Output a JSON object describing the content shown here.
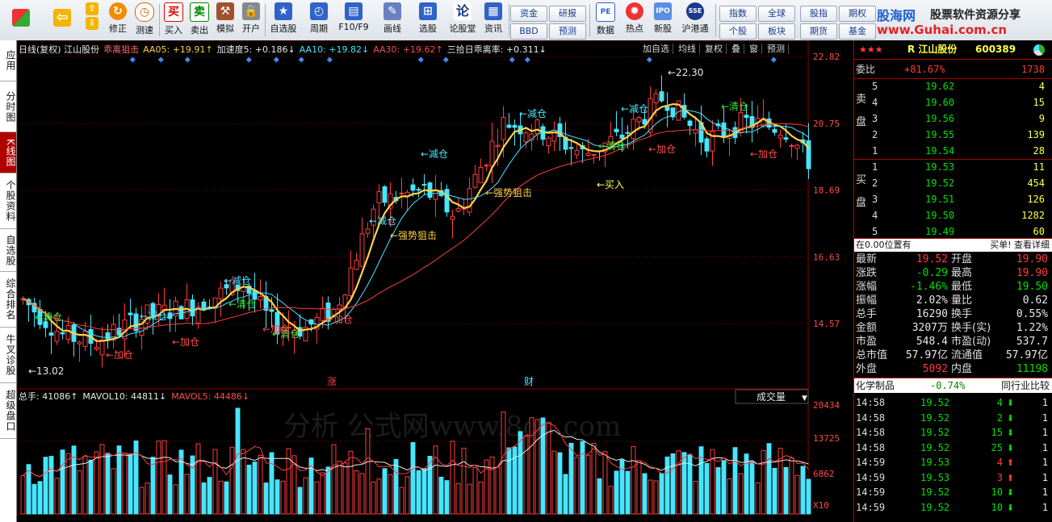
{
  "toolbar": {
    "buttons": [
      {
        "label": "",
        "icon": "app-grid-icon"
      },
      {
        "label": "",
        "icon": "back-arrow-icon"
      },
      {
        "label": "修正",
        "icon": "fix-icon"
      },
      {
        "label": "测速",
        "icon": "speed-icon"
      },
      {
        "label": "买入",
        "icon": "buy-icon"
      },
      {
        "label": "卖出",
        "icon": "sell-icon"
      },
      {
        "label": "模拟",
        "icon": "simulate-icon"
      },
      {
        "label": "开户",
        "icon": "lock-icon"
      },
      {
        "label": "自选股",
        "icon": "star-icon"
      },
      {
        "label": "周期",
        "icon": "clock-icon"
      },
      {
        "label": "F10/F9",
        "icon": "info-icon"
      },
      {
        "label": "画线",
        "icon": "pen-icon"
      },
      {
        "label": "选股",
        "icon": "select-icon"
      },
      {
        "label": "论股堂",
        "icon": "forum-icon"
      },
      {
        "label": "资讯",
        "icon": "news-icon"
      },
      {
        "label": "数据",
        "icon": "pe-icon"
      },
      {
        "label": "热点",
        "icon": "hot-icon"
      },
      {
        "label": "新股",
        "icon": "ipo-icon"
      },
      {
        "label": "沪港通",
        "icon": "hk-icon"
      }
    ],
    "small_buttons": [
      "资金",
      "BBD",
      "研报",
      "预测"
    ],
    "right_buttons": [
      "指数",
      "全球",
      "股指",
      "期权",
      "个股",
      "板块",
      "期货",
      "基金"
    ],
    "brand_line1": "股海网",
    "brand_line1b": "股票软件资源分享",
    "brand_line2": "www.Guhai.com.cn"
  },
  "sidebar": [
    "应用",
    "分时图",
    "K线图",
    "个股资料",
    "自选股",
    "综合排名",
    "牛叉诊股",
    "超级盘口"
  ],
  "chart": {
    "header": "日线(复权) 江山股份 乖离狙击 AA05: +19.91↑ 加速度5: +0.186↓ AA10: +19.82↓ AA30: +19.62↑ 三拾日乖离率: +0.311↓",
    "header_parts": [
      {
        "text": "日线(复权) 江山股份",
        "color": "#e8e8e8"
      },
      {
        "text": "乖离狙击",
        "color": "#ff6a6a"
      },
      {
        "text": "AA05: +19.91↑",
        "color": "#ffd04a"
      },
      {
        "text": "加速度5: +0.186↓",
        "color": "#e8e8e8"
      },
      {
        "text": "AA10: +19.82↓",
        "color": "#46e6ff"
      },
      {
        "text": "AA30: +19.62↑",
        "color": "#ff4a4a"
      },
      {
        "text": "三拾日乖离率: +0.311↓",
        "color": "#e8e8e8"
      }
    ],
    "tabs": [
      "加自选",
      "均线",
      "复权",
      "叠",
      "窗",
      "预测"
    ],
    "price_axis": [
      "22.82",
      "20.75",
      "18.69",
      "16.63",
      "14.57"
    ],
    "high_label": "22.30",
    "low_label": "13.02",
    "annotations": [
      {
        "text": "←清仓",
        "color": "#3ce03c"
      },
      {
        "text": "←加仓",
        "color": "#ff4a4a"
      },
      {
        "text": "←减仓",
        "color": "#46e6ff"
      },
      {
        "text": "←清仓",
        "color": "#3ce03c"
      },
      {
        "text": "←加仓",
        "color": "#ff4a4a"
      },
      {
        "text": "←减仓",
        "color": "#46e6ff"
      },
      {
        "text": "←清仓",
        "color": "#3ce03c"
      },
      {
        "text": "←加仓",
        "color": "#ff4a4a"
      },
      {
        "text": "←加仓",
        "color": "#ff4a4a"
      },
      {
        "text": "←减仓",
        "color": "#46e6ff"
      },
      {
        "text": "←强势狙击",
        "color": "#ffd04a"
      },
      {
        "text": "←减仓",
        "color": "#46e6ff"
      },
      {
        "text": "←强势狙击",
        "color": "#ffd04a"
      },
      {
        "text": "←减仓",
        "color": "#46e6ff"
      },
      {
        "text": "←清仓",
        "color": "#3ce03c"
      },
      {
        "text": "←买入",
        "color": "#ffff4a"
      },
      {
        "text": "←减仓",
        "color": "#46e6ff"
      },
      {
        "text": "←加仓",
        "color": "#ff4a4a"
      },
      {
        "text": "←清仓",
        "color": "#3ce03c"
      },
      {
        "text": "←加仓",
        "color": "#ff4a4a"
      }
    ],
    "markers": [
      "涨",
      "财"
    ],
    "volume_header_parts": [
      {
        "text": "总手: 41086↑",
        "color": "#e8e8e8"
      },
      {
        "text": "MAVOL10: 44811↓",
        "color": "#e8e8e8"
      },
      {
        "text": "MAVOL5: 44486↓",
        "color": "#ff4a4a"
      }
    ],
    "volume_tab": "成交量",
    "volume_axis": [
      "20434",
      "13725",
      "6862",
      "X10"
    ],
    "watermark": "分析 公式网www.8gs.com"
  },
  "panel": {
    "stock": "R 江山股份",
    "code": "600389",
    "committee_label": "委比",
    "committee_value": "+81.67%",
    "committee_volume": "1738",
    "sell_label": "卖盘",
    "buy_label": "买盘",
    "sell_orders": [
      {
        "n": "5",
        "price": "19.62",
        "vol": "4"
      },
      {
        "n": "4",
        "price": "19.60",
        "vol": "15"
      },
      {
        "n": "3",
        "price": "19.56",
        "vol": "9"
      },
      {
        "n": "2",
        "price": "19.55",
        "vol": "139"
      },
      {
        "n": "1",
        "price": "19.54",
        "vol": "28"
      }
    ],
    "buy_orders": [
      {
        "n": "1",
        "price": "19.53",
        "vol": "11"
      },
      {
        "n": "2",
        "price": "19.52",
        "vol": "454"
      },
      {
        "n": "3",
        "price": "19.51",
        "vol": "126"
      },
      {
        "n": "4",
        "price": "19.50",
        "vol": "1282"
      },
      {
        "n": "5",
        "price": "19.49",
        "vol": "60"
      }
    ],
    "position_text": "在0.00位置有",
    "position_link": "买单! 查看详细",
    "quotes": [
      {
        "l1": "最新",
        "v1": "19.52",
        "c1": "red",
        "l2": "开盘",
        "v2": "19.90",
        "c2": "red"
      },
      {
        "l1": "涨跌",
        "v1": "-0.29",
        "c1": "green",
        "l2": "最高",
        "v2": "19.90",
        "c2": "red"
      },
      {
        "l1": "涨幅",
        "v1": "-1.46%",
        "c1": "green",
        "l2": "最低",
        "v2": "19.50",
        "c2": "green"
      },
      {
        "l1": "振幅",
        "v1": "2.02%",
        "c1": "white",
        "l2": "量比",
        "v2": "0.62",
        "c2": "white"
      },
      {
        "l1": "总手",
        "v1": "16290",
        "c1": "white",
        "l2": "换手",
        "v2": "0.55%",
        "c2": "white"
      },
      {
        "l1": "金额",
        "v1": "3207万",
        "c1": "white",
        "l2": "换手(实)",
        "v2": "1.22%",
        "c2": "white"
      },
      {
        "l1": "市盈",
        "v1": "548.4",
        "c1": "white",
        "l2": "市盈(动)",
        "v2": "537.7",
        "c2": "white"
      },
      {
        "l1": "总市值",
        "v1": "57.97亿",
        "c1": "white",
        "l2": "流通值",
        "v2": "57.97亿",
        "c2": "white"
      },
      {
        "l1": "外盘",
        "v1": "5092",
        "c1": "red",
        "l2": "内盘",
        "v2": "11198",
        "c2": "green"
      }
    ],
    "industry": "化学制品",
    "industry_change": "-0.74%",
    "industry_link": "同行业比较",
    "ticks": [
      {
        "time": "14:58",
        "price": "19.52",
        "vol": "4",
        "dir": "down",
        "n": "1"
      },
      {
        "time": "14:58",
        "price": "19.52",
        "vol": "2",
        "dir": "down",
        "n": "1"
      },
      {
        "time": "14:58",
        "price": "19.52",
        "vol": "15",
        "dir": "down",
        "n": "1"
      },
      {
        "time": "14:58",
        "price": "19.52",
        "vol": "25",
        "dir": "down",
        "n": "1"
      },
      {
        "time": "14:59",
        "price": "19.53",
        "vol": "4",
        "dir": "up",
        "n": "1"
      },
      {
        "time": "14:59",
        "price": "19.53",
        "vol": "3",
        "dir": "up",
        "n": "1"
      },
      {
        "time": "14:59",
        "price": "19.52",
        "vol": "10",
        "dir": "down",
        "n": "1"
      },
      {
        "time": "14:59",
        "price": "19.52",
        "vol": "10",
        "dir": "down",
        "n": "1"
      }
    ]
  }
}
